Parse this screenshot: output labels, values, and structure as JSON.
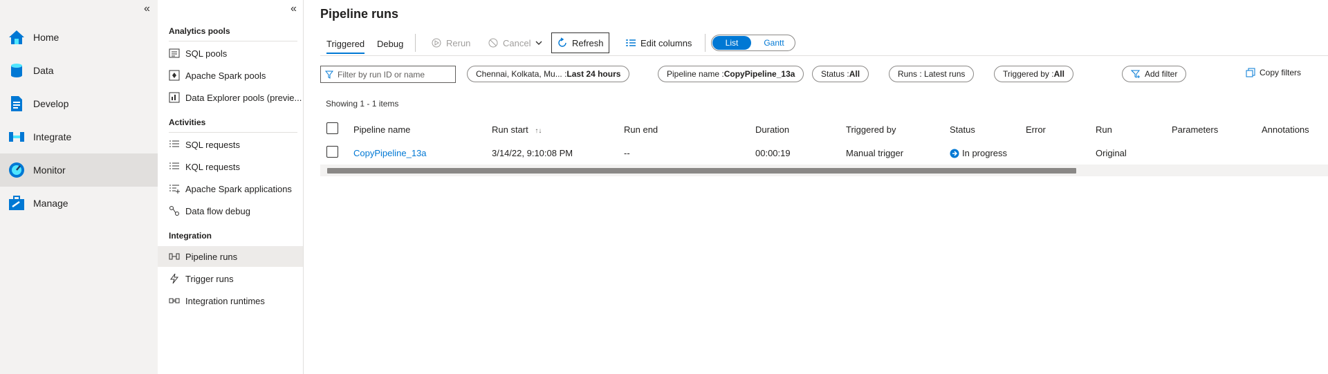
{
  "leftnav": {
    "collapse": "«",
    "items": [
      {
        "label": "Home"
      },
      {
        "label": "Data"
      },
      {
        "label": "Develop"
      },
      {
        "label": "Integrate"
      },
      {
        "label": "Monitor"
      },
      {
        "label": "Manage"
      }
    ]
  },
  "subnav": {
    "collapse": "«",
    "sections": [
      {
        "title": "Analytics pools",
        "items": [
          "SQL pools",
          "Apache Spark pools",
          "Data Explorer pools (previe..."
        ]
      },
      {
        "title": "Activities",
        "items": [
          "SQL requests",
          "KQL requests",
          "Apache Spark applications",
          "Data flow debug"
        ]
      },
      {
        "title": "Integration",
        "items": [
          "Pipeline runs",
          "Trigger runs",
          "Integration runtimes"
        ]
      }
    ]
  },
  "page": {
    "title": "Pipeline runs",
    "tabs": [
      "Triggered",
      "Debug"
    ],
    "toolbar": {
      "rerun": "Rerun",
      "cancel": "Cancel",
      "refresh": "Refresh",
      "edit_columns": "Edit columns",
      "view_list": "List",
      "view_gantt": "Gantt"
    },
    "filters": {
      "search_placeholder": "Filter by run ID or name",
      "timezone_prefix": "Chennai, Kolkata, Mu... : ",
      "timezone_value": "Last 24 hours",
      "pipeline_prefix": "Pipeline name : ",
      "pipeline_value": "CopyPipeline_13a",
      "status_prefix": "Status : ",
      "status_value": "All",
      "runs_label": "Runs : Latest runs",
      "triggered_prefix": "Triggered by : ",
      "triggered_value": "All",
      "add_filter": "Add filter",
      "copy_filters": "Copy filters"
    },
    "showing": "Showing 1 - 1 items",
    "columns": [
      "Pipeline name",
      "Run start",
      "Run end",
      "Duration",
      "Triggered by",
      "Status",
      "Error",
      "Run",
      "Parameters",
      "Annotations"
    ],
    "sort_glyph": "↑↓",
    "rows": [
      {
        "pipeline_name": "CopyPipeline_13a",
        "run_start": "3/14/22, 9:10:08 PM",
        "run_end": "--",
        "duration": "00:00:19",
        "triggered_by": "Manual trigger",
        "status": "In progress",
        "error": "",
        "run": "Original",
        "parameters": "",
        "annotations": ""
      }
    ]
  },
  "colors": {
    "accent": "#0078d4",
    "nav_bg": "#f3f2f1",
    "active_nav": "#e1dfdd"
  }
}
